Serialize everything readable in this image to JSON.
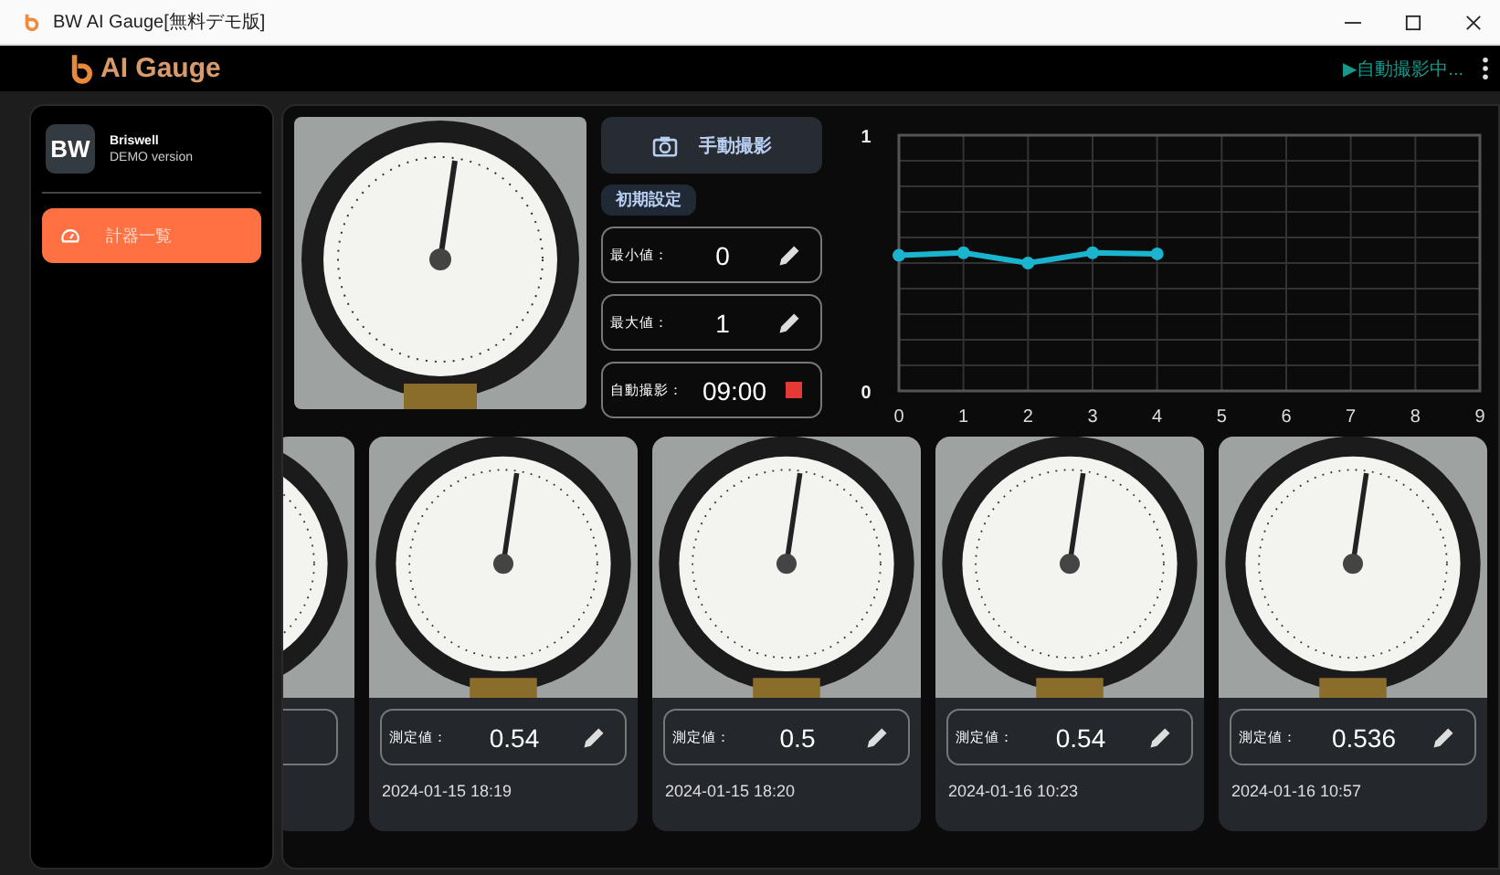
{
  "window": {
    "title": "BW AI Gauge[無料デモ版]"
  },
  "header": {
    "app_name": "AI Gauge",
    "status": "▶自動撮影中..."
  },
  "sidebar": {
    "avatar": "BW",
    "company": "Briswell",
    "edition": "DEMO version",
    "items": [
      {
        "label": "計器一覧",
        "selected": true
      }
    ]
  },
  "controls": {
    "capture_button": "手動撮影",
    "settings_label": "初期設定",
    "fields": [
      {
        "label": "最小値：",
        "value": "0",
        "kind": "edit"
      },
      {
        "label": "最大値：",
        "value": "1",
        "kind": "edit"
      },
      {
        "label": "自動撮影：",
        "value": "09:00",
        "kind": "stop"
      }
    ]
  },
  "chart_data": {
    "type": "line",
    "x": [
      0,
      1,
      2,
      3,
      4
    ],
    "grid": true,
    "series": [
      {
        "color": "#1ab4cf",
        "marker": true,
        "values": [
          0.53,
          0.54,
          0.5,
          0.54,
          0.536
        ]
      }
    ],
    "xlim": [
      0,
      9
    ],
    "ylim": [
      0,
      1
    ],
    "xticks": [
      0,
      1,
      2,
      3,
      4,
      5,
      6,
      7,
      8,
      9
    ],
    "yticks": [
      0,
      1
    ]
  },
  "cards": [
    {
      "kind": "clipped"
    },
    {
      "kind": "full",
      "label": "測定値：",
      "value": "0.54",
      "date": "2024-01-15 18:19"
    },
    {
      "kind": "full",
      "label": "測定値：",
      "value": "0.5",
      "date": "2024-01-15 18:20"
    },
    {
      "kind": "full",
      "label": "測定値：",
      "value": "0.54",
      "date": "2024-01-16 10:23"
    },
    {
      "kind": "full",
      "label": "測定値：",
      "value": "0.536",
      "date": "2024-01-16 10:57"
    }
  ]
}
